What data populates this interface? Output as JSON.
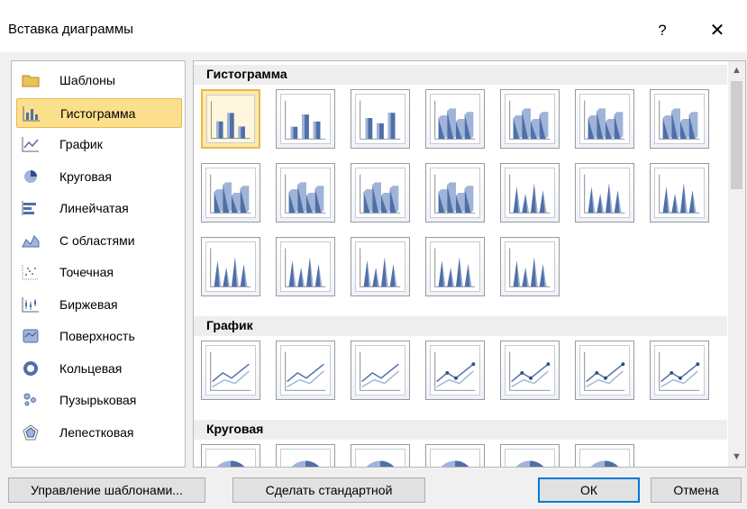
{
  "window": {
    "title": "Вставка диаграммы",
    "help": "?",
    "close": "✕"
  },
  "chart_types": [
    {
      "label": "Шаблоны",
      "icon": "folder-icon"
    },
    {
      "label": "Гистограмма",
      "icon": "column-chart-icon",
      "selected": true
    },
    {
      "label": "График",
      "icon": "line-chart-icon"
    },
    {
      "label": "Круговая",
      "icon": "pie-chart-icon"
    },
    {
      "label": "Линейчатая",
      "icon": "bar-chart-icon"
    },
    {
      "label": "С областями",
      "icon": "area-chart-icon"
    },
    {
      "label": "Точечная",
      "icon": "scatter-chart-icon"
    },
    {
      "label": "Биржевая",
      "icon": "stock-chart-icon"
    },
    {
      "label": "Поверхность",
      "icon": "surface-chart-icon"
    },
    {
      "label": "Кольцевая",
      "icon": "doughnut-chart-icon"
    },
    {
      "label": "Пузырьковая",
      "icon": "bubble-chart-icon"
    },
    {
      "label": "Лепестковая",
      "icon": "radar-chart-icon"
    }
  ],
  "gallery": {
    "sections": [
      {
        "title": "Гистограмма",
        "count": 19
      },
      {
        "title": "График",
        "count": 7
      },
      {
        "title": "Круговая",
        "count": 6
      }
    ]
  },
  "buttons": {
    "manage_templates": "Управление шаблонами...",
    "set_default": "Сделать стандартной",
    "ok": "ОК",
    "cancel": "Отмена"
  },
  "colors": {
    "accent": "#0078d7",
    "selection": "#fcdf8c",
    "chart_blue": "#4f6fa8"
  }
}
